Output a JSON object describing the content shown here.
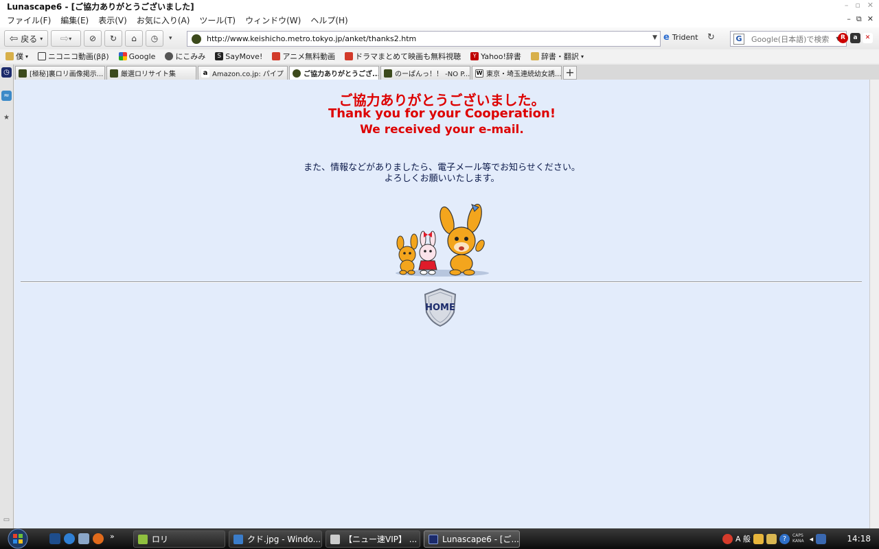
{
  "window": {
    "title": "Lunascape6 - [ご協力ありがとうございました]"
  },
  "menu": [
    "ファイル(F)",
    "編集(E)",
    "表示(V)",
    "お気に入り(A)",
    "ツール(T)",
    "ウィンドウ(W)",
    "ヘルプ(H)"
  ],
  "toolbar": {
    "back_label": "戻る",
    "url": "http://www.keishicho.metro.tokyo.jp/anket/thanks2.htm",
    "engine_label": "Trident",
    "search_placeholder": "Google(日本語)で検索"
  },
  "bookmarks": [
    {
      "label": "僕",
      "icon": "folder-icon",
      "color": "#d8b04a"
    },
    {
      "label": "ニコニコ動画(ββ)",
      "icon": "tv-icon",
      "color": "#333333"
    },
    {
      "label": "Google",
      "icon": "google-icon",
      "color": "#3b7be0"
    },
    {
      "label": "にこみみ",
      "icon": "mimi-icon",
      "color": "#555555"
    },
    {
      "label": "SayMove!",
      "icon": "s-icon",
      "color": "#222222"
    },
    {
      "label": "アニメ無料動画",
      "icon": "anime-icon",
      "color": "#d23a2a"
    },
    {
      "label": "ドラマまとめて映画も無料視聴",
      "icon": "drama-icon",
      "color": "#d23a2a"
    },
    {
      "label": "Yahoo!辞書",
      "icon": "yahoo-icon",
      "color": "#c00000"
    },
    {
      "label": "辞書・翻訳",
      "icon": "folder-icon",
      "color": "#d8b04a"
    }
  ],
  "tabs": [
    {
      "label": "[極秘]裏ロリ画像掲示...",
      "fav": "p"
    },
    {
      "label": "厳選ロリサイト集",
      "fav": "p"
    },
    {
      "label": "Amazon.co.jp: パイプ",
      "fav": "a"
    },
    {
      "label": "ご協力ありがとうござ...",
      "fav": "police",
      "active": true
    },
    {
      "label": "のーぱんっ！！ -NO P...",
      "fav": "p"
    },
    {
      "label": "東京・埼玉連続幼女誘...",
      "fav": "w"
    }
  ],
  "page": {
    "heading_ja": "ご協力ありがとうございました。",
    "heading_en": "Thank you for your Cooperation!",
    "heading_en2": "We received your e-mail.",
    "message_line1": "また、情報などがありましたら、電子メール等でお知らせください。",
    "message_line2": "よろしくお願いいたします。",
    "home_label": "HOME"
  },
  "taskbar": {
    "items": [
      {
        "label": "ロリ",
        "color": "#8fbf3f"
      },
      {
        "label": "クド.jpg - Windo...",
        "color": "#3a7cc9"
      },
      {
        "label": "【ニュー速VIP】 ...",
        "color": "#cccccc"
      },
      {
        "label": "Lunascape6 - [ご...",
        "color": "#1b2a6b"
      }
    ],
    "caps_label": "CAPS",
    "kana_label": "KANA",
    "ime_label": "A 般",
    "clock": "14:18"
  },
  "colors": {
    "accent_red": "#dd0000",
    "content_bg": "#e3ecfb",
    "text_navy": "#0c1a4a"
  }
}
